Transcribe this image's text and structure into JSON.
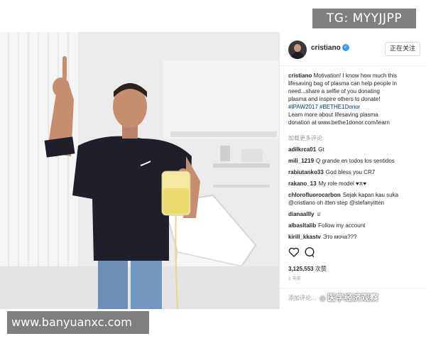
{
  "overlay": {
    "top_tag": "TG: MYYJJPP",
    "bottom_site": "www.banyuanxc.com"
  },
  "post": {
    "username": "cristiano",
    "verified_icon": "verified-badge-icon",
    "follow_label": "正在关注",
    "caption": {
      "author": "cristiano",
      "line1": "Motivation! I know how much this",
      "line2": "lifesaving bag of plasma can help people in",
      "line3": "need...share a selfie of you donating",
      "line4": "plasma and inspire others to donate!",
      "hashtags": "#IPAW2017 #BETHE1Donor",
      "line6": "Learn more about lifesaving plasma",
      "line7": "donation at www.bethe1donor.com/learn"
    },
    "load_more": "加载更多评论",
    "comments": [
      {
        "user": "adilkrca01",
        "text": "Gt"
      },
      {
        "user": "mili_1219",
        "text": "Q grande en todos los sentidos"
      },
      {
        "user": "rabiutanko33",
        "text": "God bless you CR7"
      },
      {
        "user": "rakano_13",
        "text": "My role model ♥π♥"
      },
      {
        "user": "chlorofluorocarbon",
        "text": "Sejak kapan kau suka",
        "text2": "@cristiano oh itten step @stefanyitten"
      },
      {
        "user": "dianaallly",
        "text": "♕"
      },
      {
        "user": "albasitalib",
        "text": "Follow my account"
      },
      {
        "user": "kirill_kkastv",
        "text": "Это моча???"
      }
    ],
    "likes_count": "3,125,553",
    "likes_unit": "次赞",
    "time_ago": "1 天前",
    "add_comment_placeholder": "添加评论...",
    "watermark": "医学经济观察"
  },
  "colors": {
    "link": "#003569",
    "verified": "#3897f0",
    "muted": "#999999",
    "overlay_gray": "#7f7f7f"
  }
}
